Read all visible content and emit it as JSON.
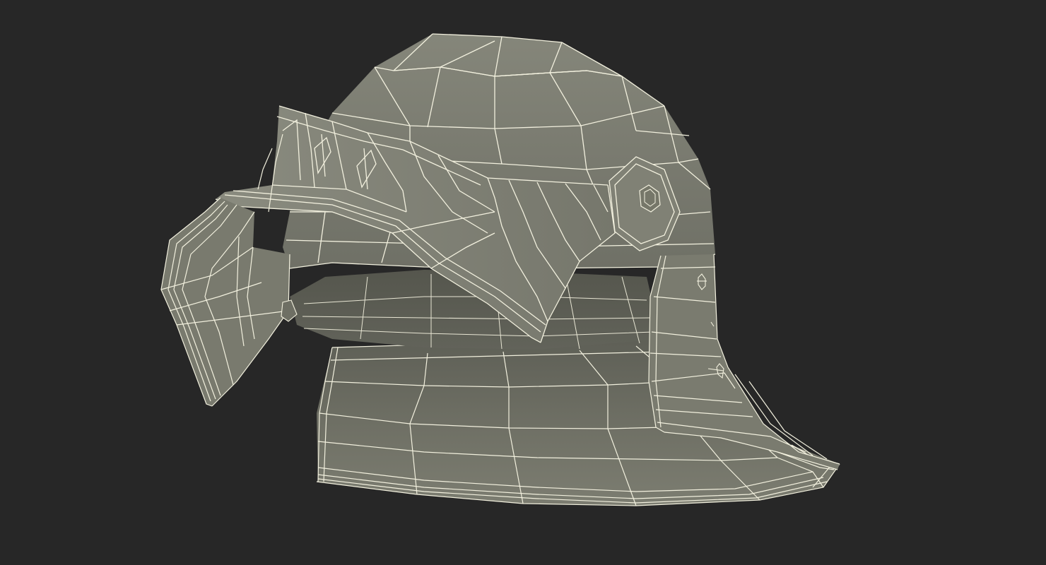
{
  "scene": {
    "subject": "helmet-wireframe-model",
    "background_color": "#272727",
    "surface_color": "#7f8073",
    "surface_dark_color": "#5f6056",
    "surface_shadow_color": "#4a4b44",
    "wire_color": "#f2f0de"
  }
}
